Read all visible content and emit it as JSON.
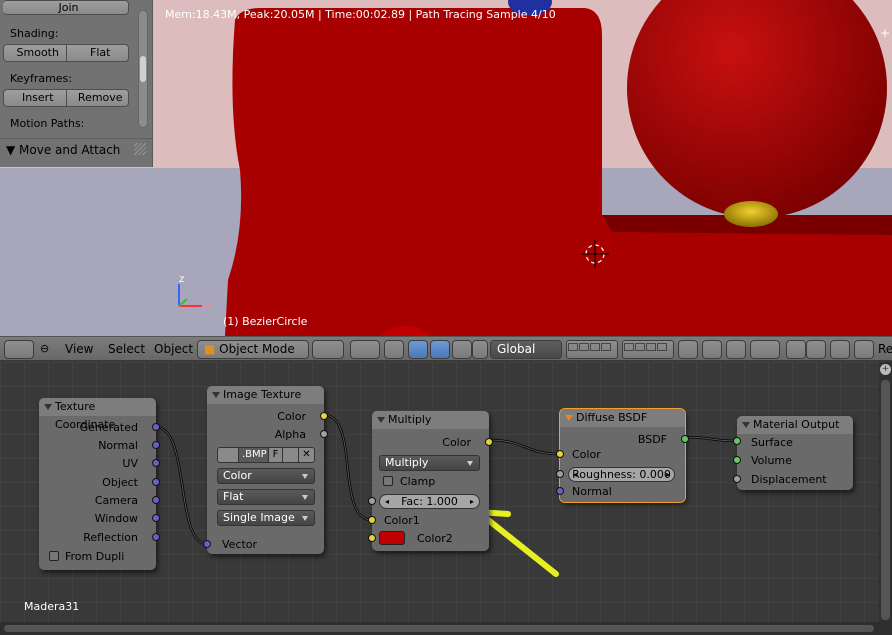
{
  "viewport": {
    "stats": "Mem:18.43M, Peak:20.05M | Time:00:02.89 | Path Tracing Sample 4/10",
    "object_name": "(1) BezierCircle",
    "axis_labels": {
      "x": "x",
      "z": "z"
    }
  },
  "toolpanel": {
    "join_label": "Join",
    "shading_label": "Shading:",
    "smooth_label": "Smooth",
    "flat_label": "Flat",
    "keyframes_label": "Keyframes:",
    "insert_label": "Insert",
    "remove_label": "Remove",
    "motion_paths_label": "Motion Paths:",
    "section_label": "Move and Attach"
  },
  "header": {
    "view_label": "View",
    "select_label": "Select",
    "object_label": "Object",
    "mode_label": "Object Mode",
    "orientation_label": "Global",
    "truncated_label": "Re"
  },
  "nodes": {
    "texcoord": {
      "title": "Texture Coordinate",
      "outputs": [
        "Generated",
        "Normal",
        "UV",
        "Object",
        "Camera",
        "Window",
        "Reflection"
      ],
      "from_dupli": "From Dupli"
    },
    "image": {
      "title": "Image Texture",
      "out_color": "Color",
      "out_alpha": "Alpha",
      "file_name": ".BMP",
      "fake_user": "F",
      "color_space": "Color",
      "interpolation": "Flat",
      "source": "Single Image",
      "in_vector": "Vector"
    },
    "multiply": {
      "title": "Multiply",
      "out_color": "Color",
      "blend_type": "Multiply",
      "clamp": "Clamp",
      "fac": "Fac: 1.000",
      "color1": "Color1",
      "color2": "Color2"
    },
    "diffuse": {
      "title": "Diffuse BSDF",
      "out_bsdf": "BSDF",
      "in_color": "Color",
      "roughness": "Roughness: 0.000",
      "in_normal": "Normal"
    },
    "output": {
      "title": "Material Output",
      "surface": "Surface",
      "volume": "Volume",
      "displacement": "Displacement"
    }
  },
  "material_name": "Madera31",
  "colors": {
    "color2_swatch": "#c00000",
    "arrow": "#e6f020",
    "sphere_red": "#b00000"
  }
}
